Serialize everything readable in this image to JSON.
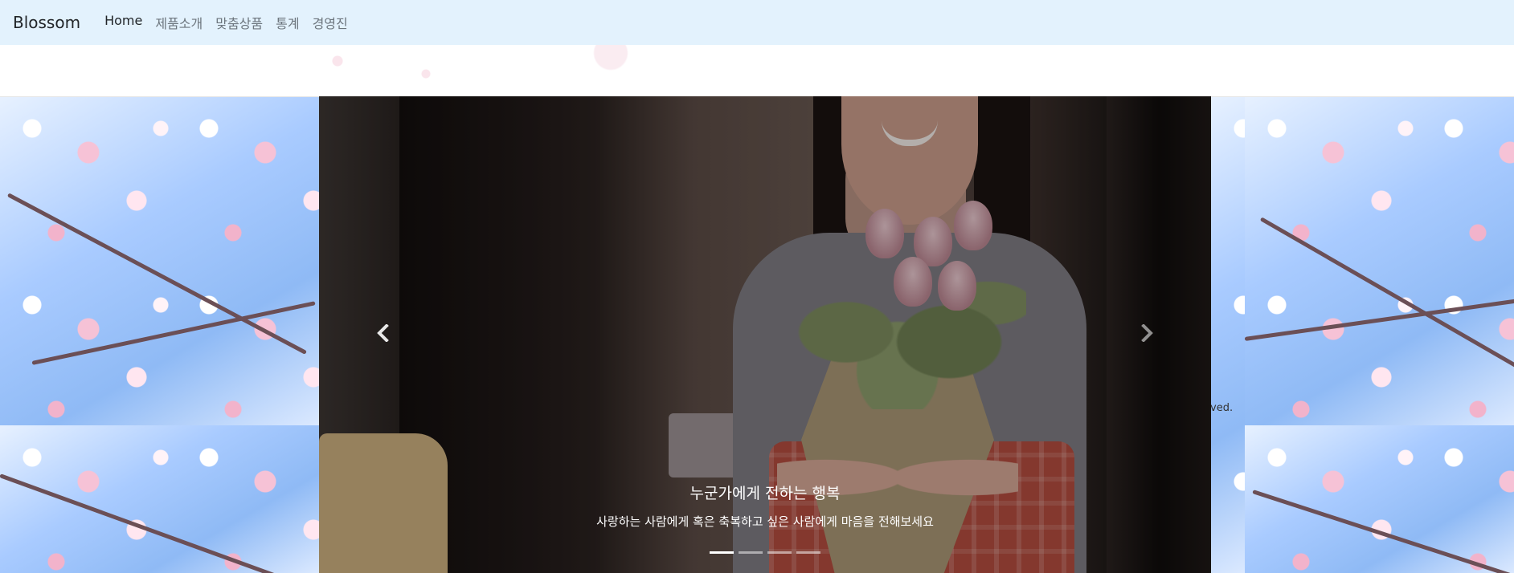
{
  "navbar": {
    "brand": "Blossom",
    "items": [
      {
        "label": "Home",
        "active": true
      },
      {
        "label": "제품소개",
        "active": false
      },
      {
        "label": "맞춤상품",
        "active": false
      },
      {
        "label": "통계",
        "active": false
      },
      {
        "label": "경영진",
        "active": false
      }
    ]
  },
  "carousel": {
    "caption_title": "누군가에게 전하는 행복",
    "caption_text": "사랑하는 사람에게 혹은 축복하고 싶은 사람에게 마음을 전해보세요",
    "slide_count": 4,
    "active_slide": 1
  },
  "footer_fragment": "ved.",
  "colors": {
    "navbar_bg": "#e3f2fd",
    "indicator_active": "#ffffff"
  },
  "icons": {
    "prev": "chevron-left-icon",
    "next": "chevron-right-icon"
  }
}
